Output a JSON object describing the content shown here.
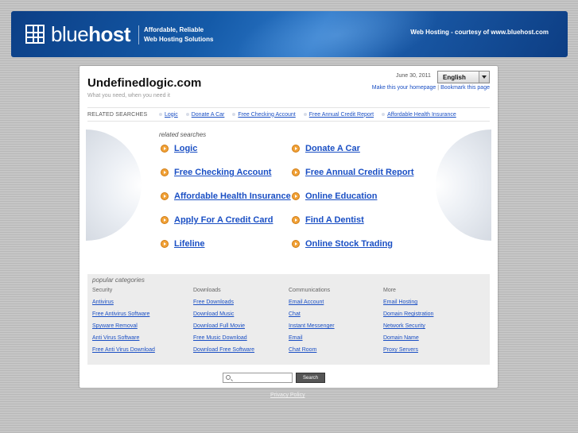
{
  "header": {
    "logo_light": "blue",
    "logo_bold": "host",
    "tagline_line1": "Affordable, Reliable",
    "tagline_line2": "Web Hosting Solutions",
    "courtesy": "Web Hosting - courtesy of www.bluehost.com"
  },
  "site": {
    "title": "Undefinedlogic.com",
    "subtitle": "What you need, when you need it",
    "date": "June 30, 2011",
    "language": "English",
    "make_homepage": "Make this your homepage",
    "bookmark": "Bookmark this page"
  },
  "related_bar": {
    "label": "RELATED SEARCHES",
    "links": [
      "Logic",
      "Donate A Car",
      "Free Checking Account",
      "Free Annual Credit Report",
      "Affordable Health Insurance"
    ]
  },
  "related_searches": {
    "label": "related searches",
    "items": [
      "Logic",
      "Donate A Car",
      "Free Checking Account",
      "Free Annual Credit Report",
      "Affordable Health Insurance",
      "Online Education",
      "Apply For A Credit Card",
      "Find A Dentist",
      "Lifeline",
      "Online Stock Trading"
    ]
  },
  "popular": {
    "title": "popular categories",
    "columns": [
      {
        "heading": "Security",
        "links": [
          "Antivirus",
          "Free Antivirus Software",
          "Spyware Removal",
          "Anti Virus Software",
          "Free Anti Virus Download"
        ]
      },
      {
        "heading": "Downloads",
        "links": [
          "Free Downloads",
          "Download Music",
          "Download Full Movie",
          "Free Music Download",
          "Download Free Software"
        ]
      },
      {
        "heading": "Communications",
        "links": [
          "Email Account",
          "Chat",
          "Instant Messenger",
          "Email",
          "Chat Room"
        ]
      },
      {
        "heading": "More",
        "links": [
          "Email Hosting",
          "Domain Registration",
          "Network Security",
          "Domain Name",
          "Proxy Servers"
        ]
      }
    ]
  },
  "search": {
    "value": "",
    "button": "Search"
  },
  "footer": {
    "privacy": "Privacy Policy"
  }
}
